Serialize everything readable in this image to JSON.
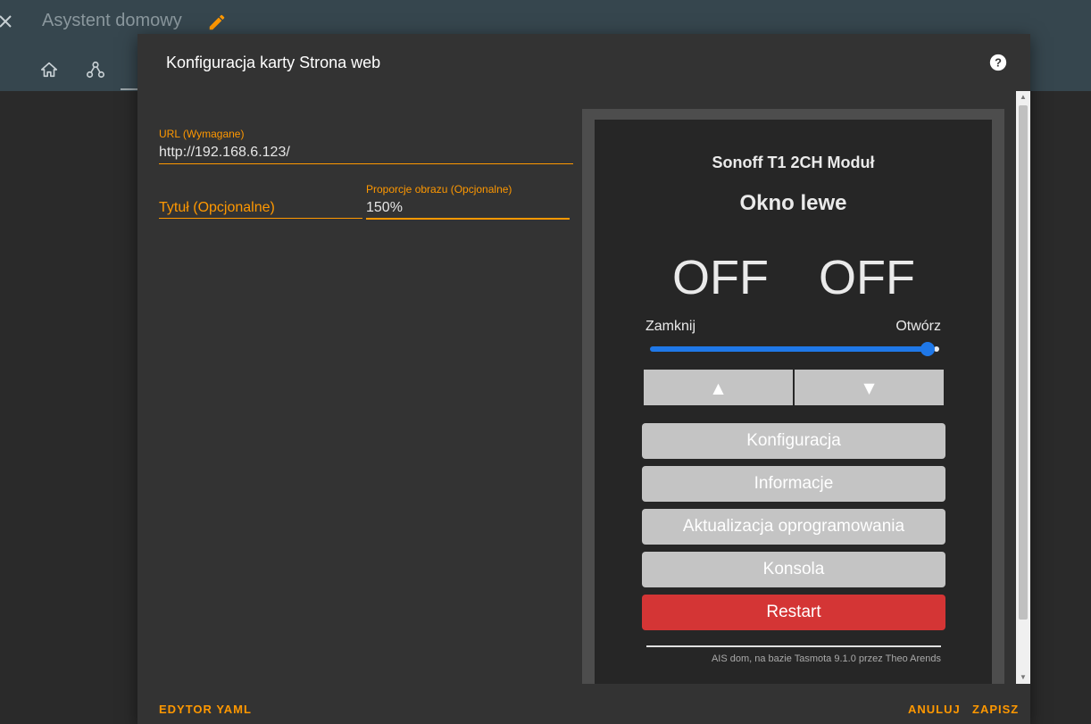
{
  "app": {
    "title": "Asystent domowy",
    "colors": {
      "header_bg": "#36464e",
      "accent": "#ff9800"
    }
  },
  "dialog": {
    "title": "Konfiguracja karty Strona web",
    "url_field": {
      "label": "URL (Wymagane)",
      "value": "http://192.168.6.123/"
    },
    "title_field": {
      "placeholder": "Tytuł (Opcjonalne)"
    },
    "aspect_field": {
      "label": "Proporcje obrazu (Opcjonalne)",
      "value": "150%"
    },
    "actions": {
      "yaml": "EDYTOR YAML",
      "cancel": "ANULUJ",
      "save": "ZAPISZ"
    }
  },
  "preview": {
    "device_name": "Sonoff T1 2CH Moduł",
    "device_label": "Okno lewe",
    "states": [
      "OFF",
      "OFF"
    ],
    "slider": {
      "left_label": "Zamknij",
      "right_label": "Otwórz",
      "level": 1.0
    },
    "arrow_up": "▲",
    "arrow_down": "▼",
    "buttons": [
      "Konfiguracja",
      "Informacje",
      "Aktualizacja oprogramowania",
      "Konsola"
    ],
    "restart": "Restart",
    "footer": "AIS dom, na bazie Tasmota 9.1.0 przez Theo Arends",
    "colors": {
      "button": "#c4c4c4",
      "restart": "#d43535",
      "slider": "#1f78e8"
    }
  },
  "icons": [
    "close-icon",
    "pencil-icon",
    "home-icon",
    "nodes-icon",
    "help-icon"
  ]
}
